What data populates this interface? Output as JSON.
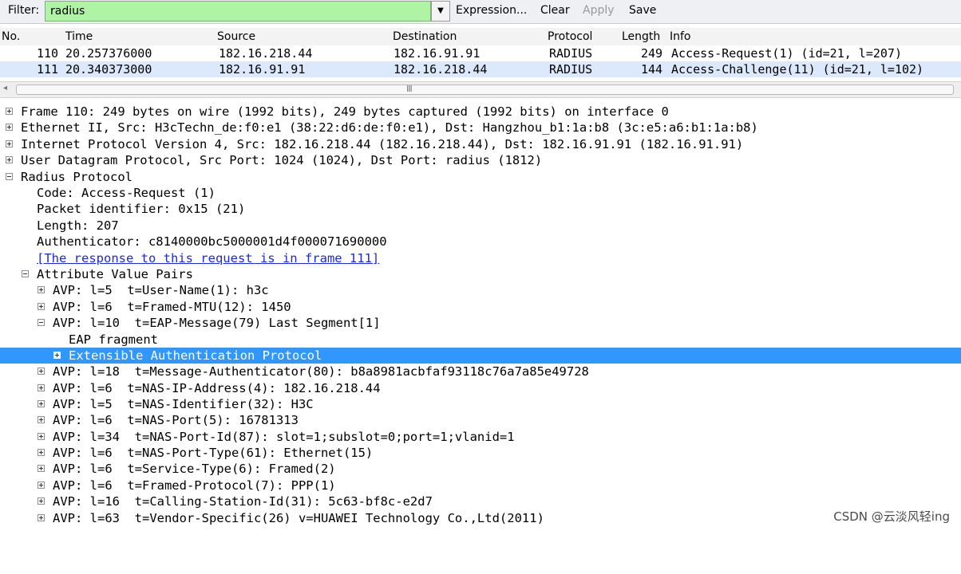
{
  "toolbar": {
    "filter_label": "Filter:",
    "filter_value": "radius",
    "expression_label": "Expression...",
    "clear_label": "Clear",
    "apply_label": "Apply",
    "save_label": "Save"
  },
  "packet_list": {
    "columns": [
      "No.",
      "Time",
      "Source",
      "Destination",
      "Protocol",
      "Length",
      "Info"
    ],
    "rows": [
      {
        "no": "110",
        "time": "20.257376000",
        "source": "182.16.218.44",
        "destination": "182.16.91.91",
        "protocol": "RADIUS",
        "length": "249",
        "info": "Access-Request(1) (id=21, l=207)"
      },
      {
        "no": "111",
        "time": "20.340373000",
        "source": "182.16.91.91",
        "destination": "182.16.218.44",
        "protocol": "RADIUS",
        "length": "144",
        "info": "Access-Challenge(11) (id=21, l=102)"
      }
    ]
  },
  "scroll_grip": "III",
  "details": {
    "frame": "Frame 110: 249 bytes on wire (1992 bits), 249 bytes captured (1992 bits) on interface 0",
    "ethernet": "Ethernet II, Src: H3cTechn_de:f0:e1 (38:22:d6:de:f0:e1), Dst: Hangzhou_b1:1a:b8 (3c:e5:a6:b1:1a:b8)",
    "ip": "Internet Protocol Version 4, Src: 182.16.218.44 (182.16.218.44), Dst: 182.16.91.91 (182.16.91.91)",
    "udp": "User Datagram Protocol, Src Port: 1024 (1024), Dst Port: radius (1812)",
    "radius": "Radius Protocol",
    "code": "Code: Access-Request (1)",
    "packet_id": "Packet identifier: 0x15 (21)",
    "length": "Length: 207",
    "authenticator": "Authenticator: c8140000bc5000001d4f000071690000",
    "response_link": "[The response to this request is in frame 111]",
    "avp_header": "Attribute Value Pairs",
    "avp_user_name": "AVP: l=5  t=User-Name(1): h3c",
    "avp_framed_mtu": "AVP: l=6  t=Framed-MTU(12): 1450",
    "avp_eap_message": "AVP: l=10  t=EAP-Message(79) Last Segment[1]",
    "eap_fragment": "EAP fragment",
    "eap_protocol": "Extensible Authentication Protocol",
    "avp_msg_auth": "AVP: l=18  t=Message-Authenticator(80): b8a8981acbfaf93118c76a7a85e49728",
    "avp_nas_ip": "AVP: l=6  t=NAS-IP-Address(4): 182.16.218.44",
    "avp_nas_identifier": "AVP: l=5  t=NAS-Identifier(32): H3C",
    "avp_nas_port": "AVP: l=6  t=NAS-Port(5): 16781313",
    "avp_nas_port_id": "AVP: l=34  t=NAS-Port-Id(87): slot=1;subslot=0;port=1;vlanid=1",
    "avp_nas_port_type": "AVP: l=6  t=NAS-Port-Type(61): Ethernet(15)",
    "avp_service_type": "AVP: l=6  t=Service-Type(6): Framed(2)",
    "avp_framed_protocol": "AVP: l=6  t=Framed-Protocol(7): PPP(1)",
    "avp_calling_station": "AVP: l=16  t=Calling-Station-Id(31): 5c63-bf8c-e2d7",
    "avp_vendor_specific": "AVP: l=63  t=Vendor-Specific(26) v=HUAWEI Technology Co.,Ltd(2011)"
  },
  "watermark": "CSDN @云淡风轻ing",
  "colors": {
    "filter_bg": "#aff4a5",
    "selected_row": "#3297fd",
    "selected_packet": "#dce8fb",
    "link": "#1f2bd6"
  }
}
